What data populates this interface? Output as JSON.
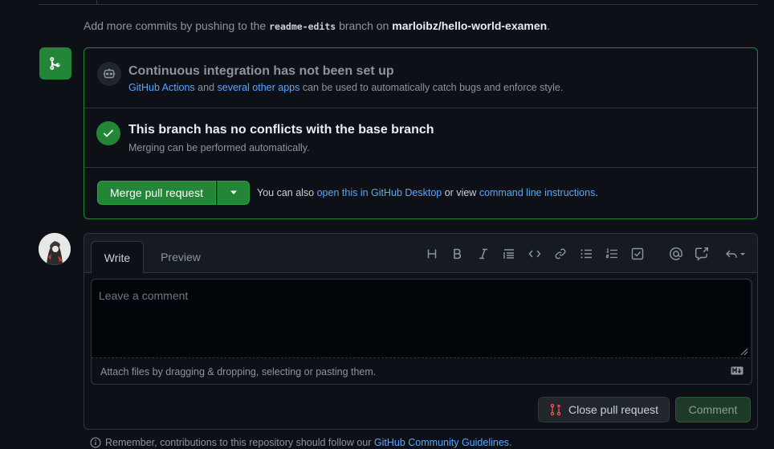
{
  "hint": {
    "prefix": "Add more commits by pushing to the",
    "branch": "readme-edits",
    "middle": "branch on",
    "repo": "marloibz/hello-world-examen",
    "suffix": "."
  },
  "ci": {
    "title": "Continuous integration has not been set up",
    "link1": "GitHub Actions",
    "and": "and",
    "link2": "several other apps",
    "rest": "can be used to automatically catch bugs and enforce style."
  },
  "conflicts": {
    "title": "This branch has no conflicts with the base branch",
    "desc": "Merging can be performed automatically."
  },
  "merge": {
    "button_label": "Merge pull request",
    "also_prefix": "You can also",
    "desktop_link": "open this in GitHub Desktop",
    "or_view": "or view",
    "cli_link": "command line instructions",
    "period": "."
  },
  "comment": {
    "tab_write": "Write",
    "tab_preview": "Preview",
    "placeholder": "Leave a comment",
    "attach_hint": "Attach files by dragging & dropping, selecting or pasting them.",
    "close_label": "Close pull request",
    "comment_label": "Comment"
  },
  "toolbar_icons": [
    "heading-icon",
    "bold-icon",
    "italic-icon",
    "quote-icon",
    "code-icon",
    "link-icon",
    "unordered-list-icon",
    "ordered-list-icon",
    "task-list-icon",
    "mention-icon",
    "reference-icon",
    "reply-icon"
  ],
  "footer": {
    "prefix": "Remember, contributions to this repository should follow our",
    "link": "GitHub Community Guidelines",
    "suffix": "."
  },
  "colors": {
    "background": "#0d1117",
    "success": "#238636",
    "link": "#58a6ff",
    "danger": "#f85149"
  }
}
